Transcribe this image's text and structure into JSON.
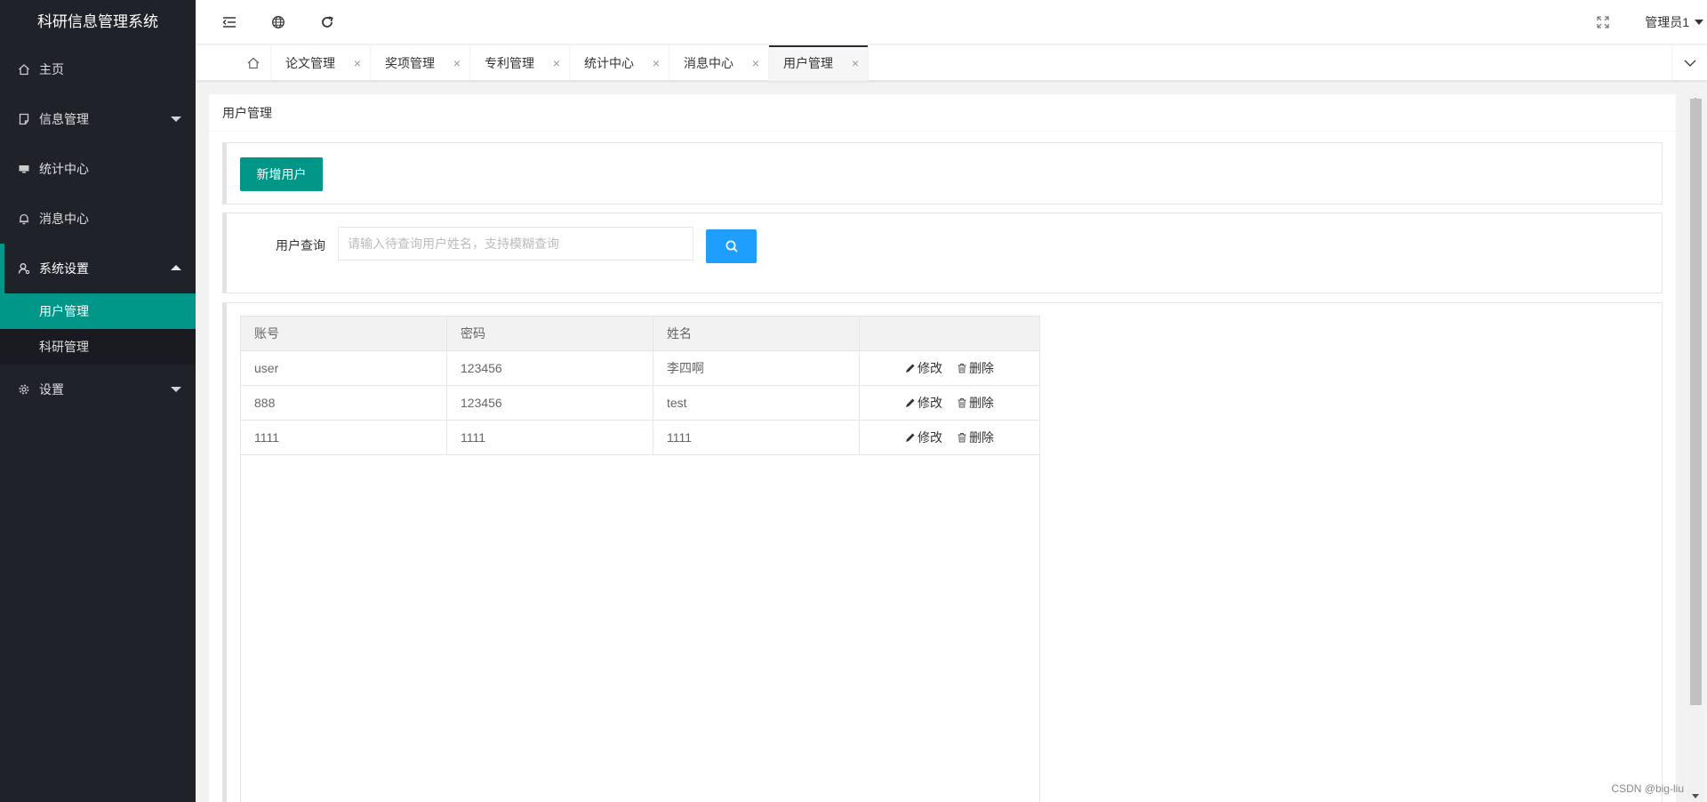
{
  "app": {
    "title": "科研信息管理系统"
  },
  "sidebar": {
    "items": [
      {
        "label": "主页",
        "icon": "home-icon"
      },
      {
        "label": "信息管理",
        "icon": "document-icon",
        "expandable": true
      },
      {
        "label": "统计中心",
        "icon": "monitor-icon"
      },
      {
        "label": "消息中心",
        "icon": "bell-icon"
      },
      {
        "label": "系统设置",
        "icon": "user-settings-icon",
        "expanded": true
      },
      {
        "label": "设置",
        "icon": "gear-icon",
        "expandable": true
      }
    ],
    "submenu": [
      {
        "label": "用户管理",
        "active": true
      },
      {
        "label": "科研管理"
      }
    ]
  },
  "header": {
    "icons": [
      "shrink-menu-icon",
      "globe-icon",
      "refresh-icon",
      "fullscreen-icon"
    ],
    "user": "管理员1"
  },
  "tabs": {
    "items": [
      {
        "label": "论文管理"
      },
      {
        "label": "奖项管理"
      },
      {
        "label": "专利管理"
      },
      {
        "label": "统计中心"
      },
      {
        "label": "消息中心"
      },
      {
        "label": "用户管理",
        "active": true
      }
    ],
    "close_glyph": "×"
  },
  "page": {
    "title": "用户管理",
    "add_button": "新增用户",
    "search_label": "用户查询",
    "search_placeholder": "请输入待查询用户姓名，支持模糊查询"
  },
  "table": {
    "headers": [
      "账号",
      "密码",
      "姓名",
      ""
    ],
    "rows": [
      {
        "account": "user",
        "password": "123456",
        "name": "李四啊"
      },
      {
        "account": "888",
        "password": "123456",
        "name": "test"
      },
      {
        "account": "1111",
        "password": "1111",
        "name": "1111"
      }
    ],
    "edit_label": "修改",
    "delete_label": "删除"
  },
  "watermark": "CSDN @big-liu",
  "colors": {
    "sidebar_bg": "#20222A",
    "accent": "#009688",
    "search_button": "#1E9FFF"
  }
}
